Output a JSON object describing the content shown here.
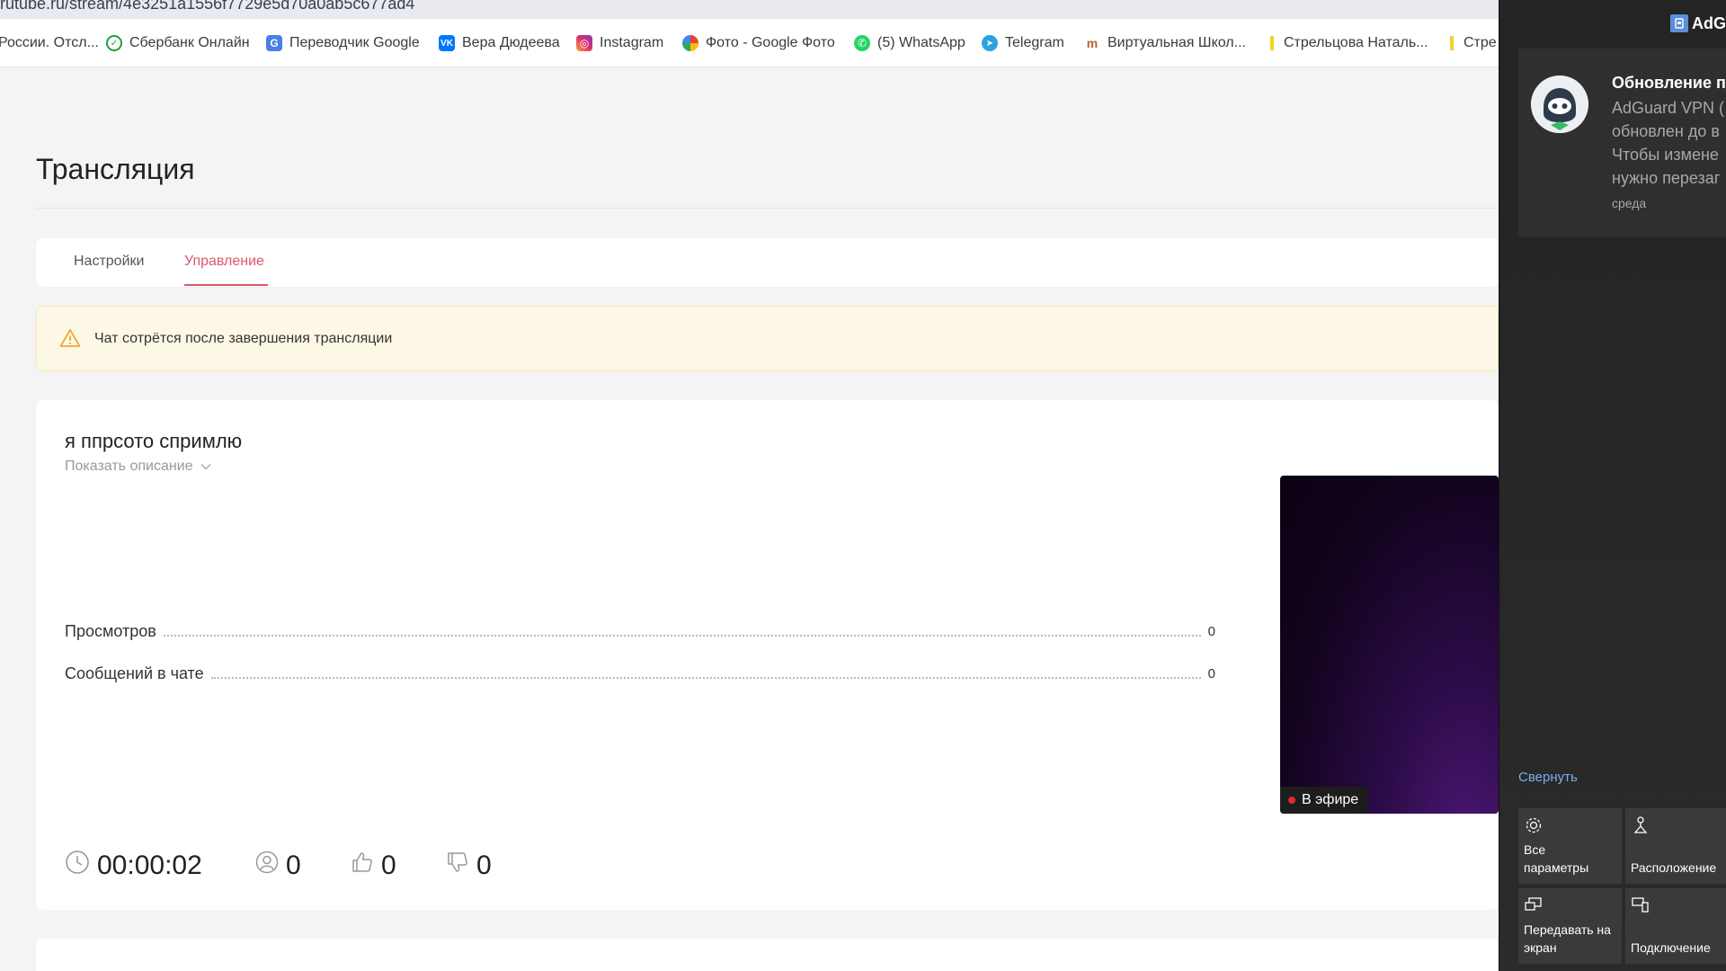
{
  "browser": {
    "url": "rutube.ru/stream/4e3251a1556f7729e5d70a0ab5c677ad4",
    "bookmarks": [
      {
        "label": "России. Отсл...",
        "icon": "doc-icon"
      },
      {
        "label": "Сбербанк Онлайн",
        "icon": "sberbank-icon"
      },
      {
        "label": "Переводчик Google",
        "icon": "translate-icon"
      },
      {
        "label": "Вера Дюдеева",
        "icon": "vk-icon"
      },
      {
        "label": "Instagram",
        "icon": "instagram-icon"
      },
      {
        "label": "Фото - Google Фото",
        "icon": "google-photos-icon"
      },
      {
        "label": "(5) WhatsApp",
        "icon": "whatsapp-icon"
      },
      {
        "label": "Telegram",
        "icon": "telegram-icon"
      },
      {
        "label": "Виртуальная Школ...",
        "icon": "school-icon"
      },
      {
        "label": "Стрельцова Наталь...",
        "icon": "bookmark-icon"
      },
      {
        "label": "Стре",
        "icon": "bookmark-icon"
      }
    ]
  },
  "page": {
    "title": "Трансляция",
    "tabs": [
      {
        "label": "Настройки",
        "active": false
      },
      {
        "label": "Управление",
        "active": true
      }
    ],
    "alert": "Чат сотрётся после завершения трансляции",
    "stream": {
      "title": "я ппрсото спримлю",
      "show_description": "Показать описание",
      "stats": [
        {
          "label": "Просмотров",
          "value": "0"
        },
        {
          "label": "Сообщений в чате",
          "value": "0"
        }
      ],
      "metrics": {
        "duration": "00:00:02",
        "viewers": "0",
        "likes": "0",
        "dislikes": "0"
      },
      "live_label": "В эфире"
    }
  },
  "action_center": {
    "app_name": "AdG",
    "notification": {
      "title": "Обновление п",
      "lines": [
        "AdGuard VPN (",
        "обновлен до в",
        "Чтобы измене",
        "нужно перезаг"
      ],
      "time": "среда"
    },
    "collapse_label": "Свернуть",
    "quick_actions": [
      {
        "label_lines": [
          "Все",
          "параметры"
        ],
        "icon": "gear-icon"
      },
      {
        "label_lines": [
          "Расположение"
        ],
        "icon": "location-icon"
      },
      {
        "label_lines": [
          "Передавать на",
          "экран"
        ],
        "icon": "project-icon"
      },
      {
        "label_lines": [
          "Подключение"
        ],
        "icon": "connect-icon"
      }
    ]
  },
  "colors": {
    "accent": "#e0566b",
    "live_dot": "#e52b2b",
    "link_blue": "#78aef0"
  }
}
